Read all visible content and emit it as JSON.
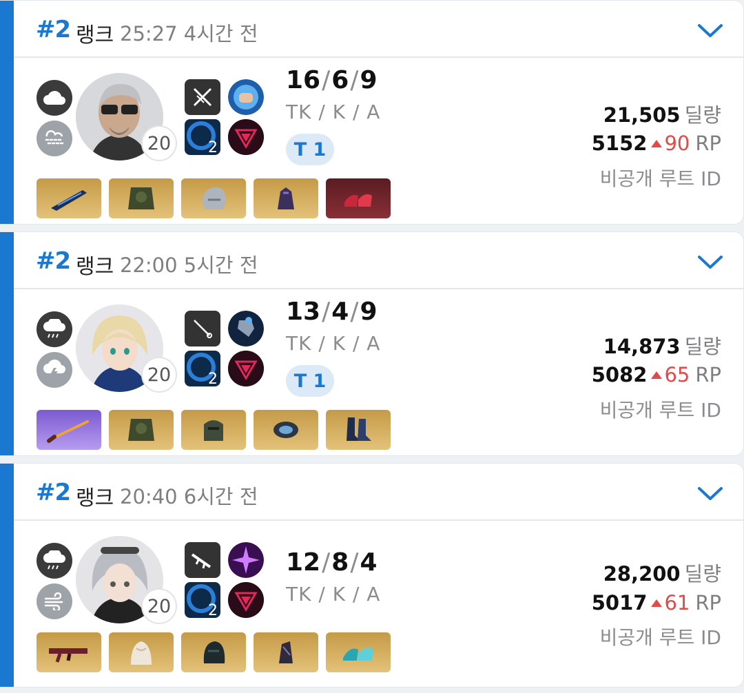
{
  "matches": [
    {
      "rank": "#2",
      "mode": "랭크",
      "duration": "25:27",
      "ago": "4시간 전",
      "weather": [
        "cloud-icon",
        "wind-dust-icon"
      ],
      "level": "20",
      "weapon_icon": "dual-swords-icon",
      "tactical_level": "2",
      "kills": "16",
      "deaths": "6",
      "assists": "9",
      "kda_label": "TK / K / A",
      "tier": "T 1",
      "damage": "21,505",
      "damage_unit": "딜량",
      "rp": "5152",
      "rp_delta": "90",
      "rp_unit": "RP",
      "route": "비공개 루트 ID",
      "items": [
        "blue-weapon",
        "green-armor",
        "silver-helmet",
        "purple-gloves",
        "red-shoes"
      ],
      "item_grades": [
        "gold",
        "gold",
        "gold",
        "gold",
        "red"
      ]
    },
    {
      "rank": "#2",
      "mode": "랭크",
      "duration": "22:00",
      "ago": "5시간 전",
      "weather": [
        "rain-cloud-icon",
        "storm-cloud-icon"
      ],
      "level": "20",
      "weapon_icon": "rapier-icon",
      "tactical_level": "2",
      "kills": "13",
      "deaths": "4",
      "assists": "9",
      "kda_label": "TK / K / A",
      "tier": "T 1",
      "damage": "14,873",
      "damage_unit": "딜량",
      "rp": "5082",
      "rp_delta": "65",
      "rp_unit": "RP",
      "route": "비공개 루트 ID",
      "items": [
        "light-saber",
        "green-armor",
        "knight-helmet",
        "blue-bracelet",
        "blue-boots"
      ],
      "item_grades": [
        "purple",
        "gold",
        "gold",
        "gold",
        "gold"
      ]
    },
    {
      "rank": "#2",
      "mode": "랭크",
      "duration": "20:40",
      "ago": "6시간 전",
      "weather": [
        "rain-cloud-icon",
        "wind-icon"
      ],
      "level": "20",
      "weapon_icon": "assault-rifle-icon",
      "tactical_level": "2",
      "kills": "12",
      "deaths": "8",
      "assists": "4",
      "kda_label": "TK / K / A",
      "tier": "",
      "damage": "28,200",
      "damage_unit": "딜량",
      "rp": "5017",
      "rp_delta": "61",
      "rp_unit": "RP",
      "route": "비공개 루트 ID",
      "items": [
        "red-rifle",
        "white-cloak",
        "dark-hood",
        "dark-arm",
        "teal-heels"
      ],
      "item_grades": [
        "gold",
        "gold",
        "gold",
        "gold",
        "gold"
      ]
    }
  ],
  "colors": {
    "accent": "#1b78d0",
    "rp_up": "#e24a4a",
    "tier_bg": "#dce9f7"
  }
}
